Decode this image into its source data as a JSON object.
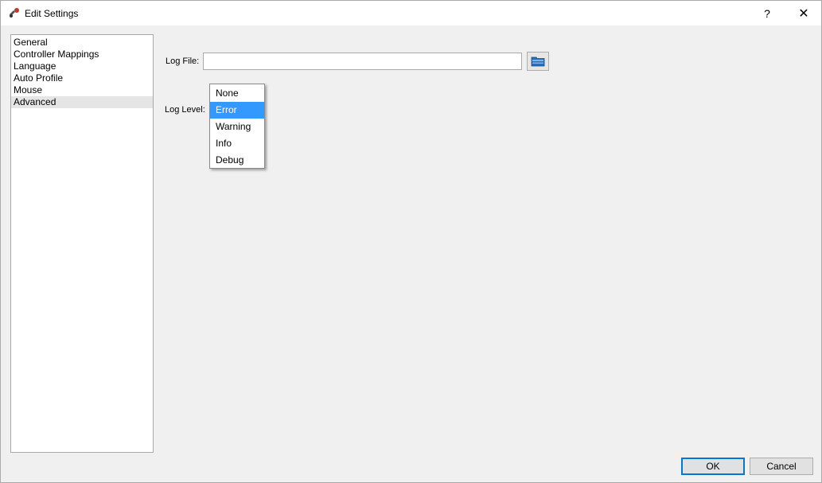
{
  "window": {
    "title": "Edit Settings",
    "help_label": "?",
    "close_label": "✕"
  },
  "sidebar": {
    "items": [
      {
        "label": "General"
      },
      {
        "label": "Controller Mappings"
      },
      {
        "label": "Language"
      },
      {
        "label": "Auto Profile"
      },
      {
        "label": "Mouse"
      },
      {
        "label": "Advanced",
        "selected": true
      }
    ]
  },
  "advanced": {
    "log_file_label": "Log File:",
    "log_file_value": "",
    "log_level_label": "Log Level:",
    "log_level_options": [
      "None",
      "Error",
      "Warning",
      "Info",
      "Debug"
    ],
    "log_level_highlighted": "Error"
  },
  "footer": {
    "ok_label": "OK",
    "cancel_label": "Cancel"
  },
  "colors": {
    "highlight": "#3399ff",
    "accent_border": "#0078d7"
  },
  "icons": {
    "app": "gamepad-icon",
    "browse": "folder-icon"
  }
}
